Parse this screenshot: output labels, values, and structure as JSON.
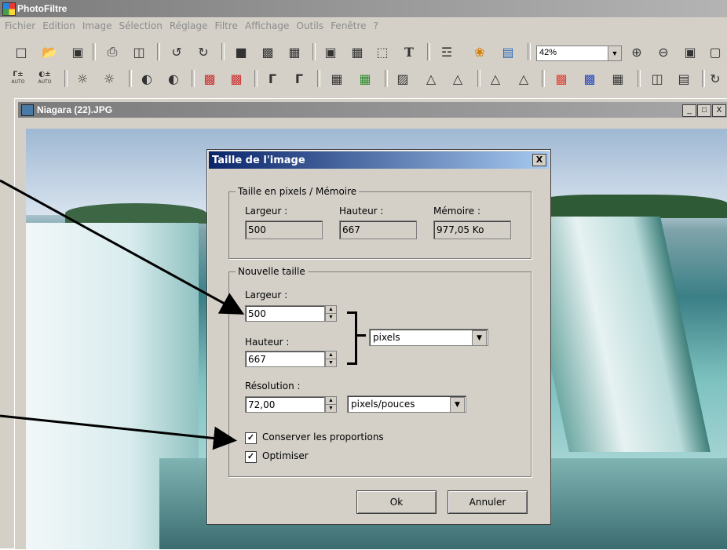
{
  "app": {
    "title": "PhotoFiltre"
  },
  "menu": [
    "Fichier",
    "Edition",
    "Image",
    "Sélection",
    "Réglage",
    "Filtre",
    "Affichage",
    "Outils",
    "Fenêtre",
    "?"
  ],
  "toolbar": {
    "zoom": "42%",
    "row1": [
      "new-icon",
      "open-icon",
      "save-icon",
      "print-icon",
      "scan-icon",
      "undo-icon",
      "redo-icon",
      "fill-color-icon",
      "palette-icon",
      "histogram-icon",
      "select-icon",
      "crop-icon",
      "marquee-icon",
      "text-icon",
      "browse-icon",
      "effects-icon",
      "window-icon",
      "zoom-in-icon",
      "zoom-out-icon",
      "fit-icon",
      "actual-size-icon"
    ],
    "row2_labels": {
      "auto1": "AUTO",
      "auto2": "AUTO"
    }
  },
  "document": {
    "title": "Niagara (22).JPG",
    "buttons": [
      "_",
      "□",
      "X"
    ]
  },
  "dialog": {
    "title": "Taille de l'image",
    "close": "X",
    "memory_group": {
      "label": "Taille en pixels / Mémoire",
      "width_label": "Largeur :",
      "height_label": "Hauteur :",
      "memory_label": "Mémoire :",
      "width_value": "500",
      "height_value": "667",
      "memory_value": "977,05 Ko"
    },
    "new_size_group": {
      "label": "Nouvelle taille",
      "width_label": "Largeur :",
      "width_value": "500",
      "height_label": "Hauteur :",
      "height_value": "667",
      "unit": "pixels",
      "resolution_label": "Résolution :",
      "resolution_value": "72,00",
      "resolution_unit": "pixels/pouces",
      "keep_proportions": "Conserver les proportions",
      "keep_proportions_checked": true,
      "optimize": "Optimiser",
      "optimize_checked": true
    },
    "ok": "Ok",
    "cancel": "Annuler"
  },
  "colors": {
    "dialog_title_start": "#0a246a",
    "dialog_title_end": "#a6caf0",
    "chrome": "#d4d0c8"
  }
}
